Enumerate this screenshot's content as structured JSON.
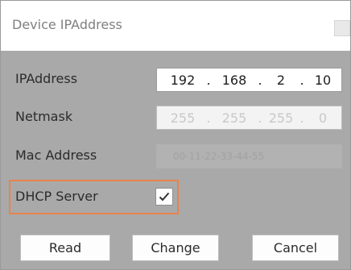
{
  "window": {
    "title": "Device IPAddress"
  },
  "fields": {
    "ip": {
      "label": "IPAddress",
      "octets": [
        "192",
        "168",
        "2",
        "10"
      ]
    },
    "netmask": {
      "label": "Netmask",
      "octets": [
        "255",
        "255",
        "255",
        "0"
      ]
    },
    "mac": {
      "label": "Mac Address",
      "value": "00-11-22-33-44-55"
    },
    "dhcp": {
      "label": "DHCP Server",
      "checked": true
    }
  },
  "buttons": {
    "read": "Read",
    "change": "Change",
    "cancel": "Cancel"
  },
  "colors": {
    "highlight": "#e8834a",
    "dialog_bg": "#a9a9a9"
  }
}
